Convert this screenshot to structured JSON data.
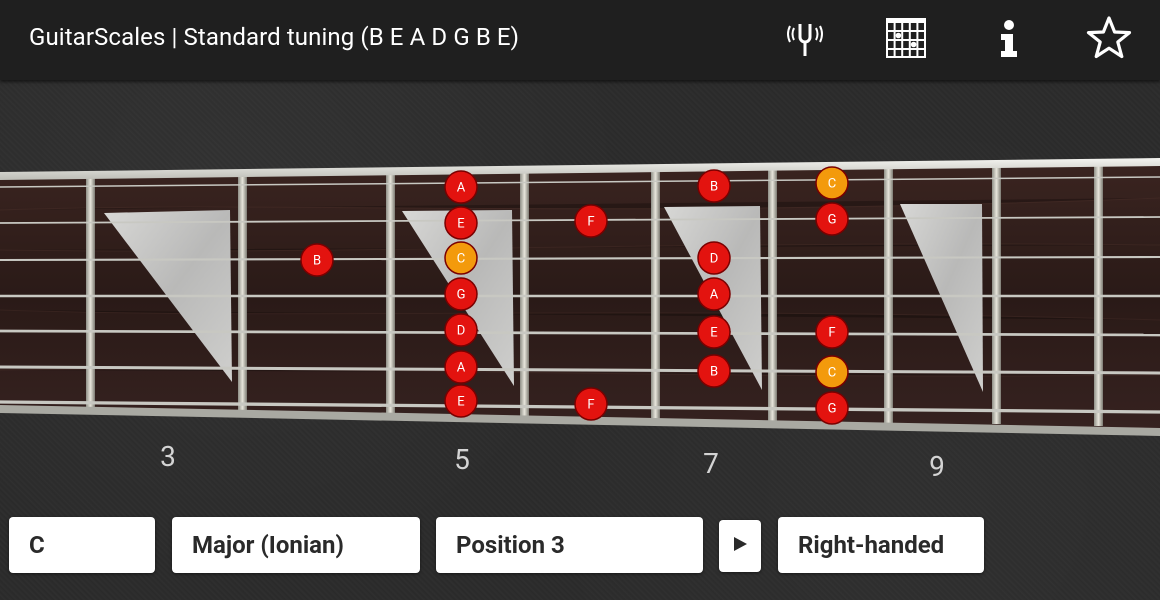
{
  "app_bar": {
    "title": "GuitarScales | Standard tuning (B E A D G B E)",
    "actions": [
      {
        "name": "tuning-fork-icon",
        "purpose": "tuner"
      },
      {
        "name": "chord-grid-icon",
        "purpose": "chord chart"
      },
      {
        "name": "info-icon",
        "purpose": "info"
      },
      {
        "name": "star-icon",
        "purpose": "favorite"
      }
    ]
  },
  "fretboard": {
    "fret_numbers": [
      "3",
      "5",
      "7",
      "9"
    ],
    "colors": {
      "note": "#e3130f",
      "root_note": "#f39a0c",
      "fretboard_wood": "#2d1c19",
      "inlay": "#c8c8c8"
    },
    "notes": [
      {
        "label": "B",
        "root": false
      },
      {
        "label": "A",
        "root": false
      },
      {
        "label": "E",
        "root": false
      },
      {
        "label": "C",
        "root": true
      },
      {
        "label": "G",
        "root": false
      },
      {
        "label": "D",
        "root": false
      },
      {
        "label": "A",
        "root": false
      },
      {
        "label": "E",
        "root": false
      },
      {
        "label": "F",
        "root": false
      },
      {
        "label": "F",
        "root": false
      },
      {
        "label": "B",
        "root": false
      },
      {
        "label": "D",
        "root": false
      },
      {
        "label": "A",
        "root": false
      },
      {
        "label": "E",
        "root": false
      },
      {
        "label": "B",
        "root": false
      },
      {
        "label": "C",
        "root": true
      },
      {
        "label": "G",
        "root": false
      },
      {
        "label": "F",
        "root": false
      },
      {
        "label": "C",
        "root": true
      },
      {
        "label": "G",
        "root": false
      }
    ]
  },
  "controls": {
    "key": "C",
    "scale": "Major (Ionian)",
    "position": "Position 3",
    "play_icon": "play-icon",
    "handedness": "Right-handed"
  }
}
